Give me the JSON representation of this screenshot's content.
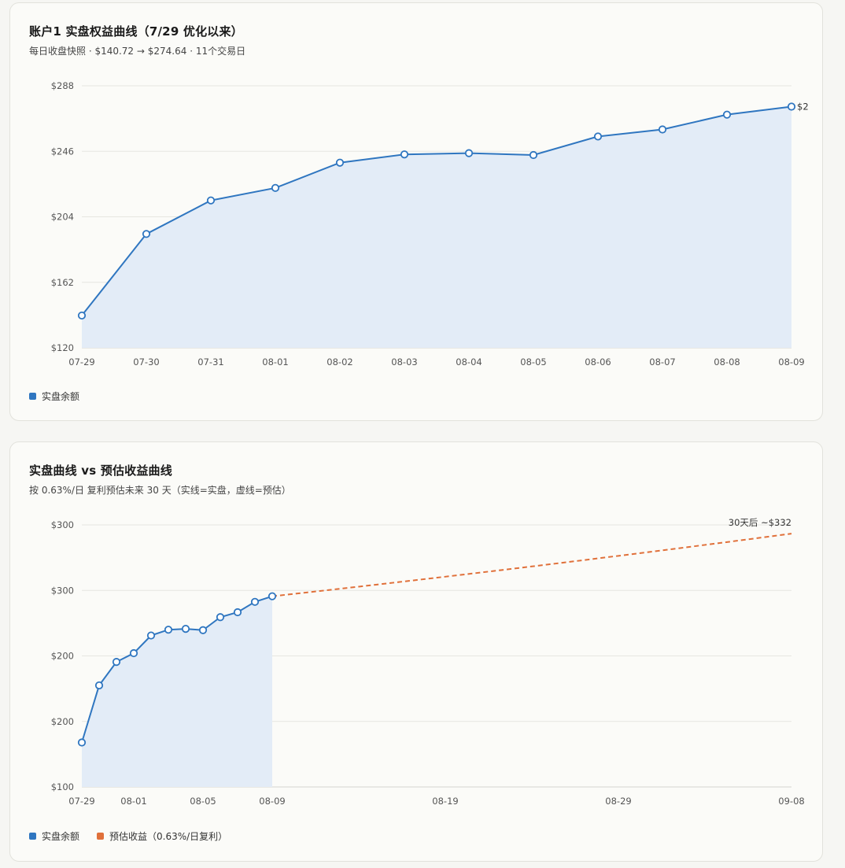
{
  "chart_data": [
    {
      "type": "area",
      "title": "账户1 实盘权益曲线（7/29 优化以来）",
      "subtitle": "每日收盘快照 · $140.72 → $274.64 · 11个交易日",
      "categories": [
        "07-29",
        "07-30",
        "07-31",
        "08-01",
        "08-02",
        "08-03",
        "08-04",
        "08-05",
        "08-06",
        "08-07",
        "08-08",
        "08-09"
      ],
      "y_ticks": [
        "$120",
        "$162",
        "$204",
        "$246",
        "$288"
      ],
      "ylim": [
        120,
        288
      ],
      "grid": true,
      "legend_position": "bottom-left",
      "series": [
        {
          "name": "实盘余额",
          "color": "#2f76c0",
          "values": [
            140.72,
            193,
            214.5,
            222.5,
            238.7,
            244,
            244.8,
            243.6,
            255.5,
            260,
            269.5,
            274.64
          ]
        }
      ],
      "end_label": "$2"
    },
    {
      "type": "line",
      "title": "实盘曲线 vs 预估收益曲线",
      "subtitle": "按 0.63%/日 复利预估未来 30 天（实线=实盘，虚线=预估）",
      "x_ticks": [
        "07-29",
        "08-01",
        "08-05",
        "08-09",
        "08-19",
        "08-29",
        "09-08"
      ],
      "y_ticks": [
        "$100",
        "$200",
        "$200",
        "$300",
        "$300"
      ],
      "ylim": [
        100,
        340
      ],
      "grid": true,
      "legend_position": "bottom-left",
      "actual": {
        "name": "实盘余额",
        "color": "#2f76c0",
        "day_index": [
          0,
          1,
          2,
          3,
          4,
          5,
          6,
          7,
          8,
          9,
          10,
          11
        ],
        "values": [
          140.72,
          193,
          214.5,
          222.5,
          238.7,
          244,
          244.8,
          243.6,
          255.5,
          260,
          269.5,
          274.64
        ]
      },
      "forecast": {
        "name": "预估收益（0.63%/日复利）",
        "color": "#e0703a",
        "start_day": 11,
        "end_day": 41,
        "start_value": 274.64,
        "end_value": 332,
        "end_label": "30天后 ~$332"
      }
    }
  ]
}
